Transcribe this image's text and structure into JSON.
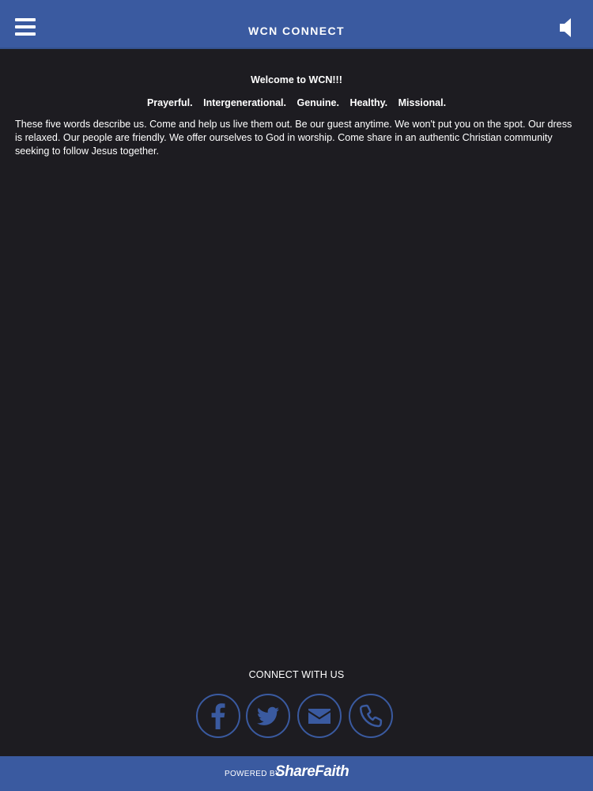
{
  "header": {
    "title": "WCN CONNECT",
    "menu_icon": "hamburger-menu-icon",
    "speaker_icon": "speaker-icon"
  },
  "content": {
    "welcome": "Welcome to WCN!!!",
    "values": [
      "Prayerful.",
      "Intergenerational.",
      "Genuine.",
      "Healthy.",
      "Missional."
    ],
    "description": "These five words describe us. Come and help us live them out.  Be our guest anytime. We won't put you on the spot. Our dress is relaxed. Our people are friendly. We offer ourselves to God in worship. Come share in an authentic Christian community seeking to follow Jesus together."
  },
  "connect": {
    "label": "CONNECT WITH US",
    "icons": [
      "facebook-icon",
      "twitter-icon",
      "email-icon",
      "phone-icon"
    ]
  },
  "footer": {
    "powered_by": "POWERED BY",
    "brand": "ShareFaith"
  },
  "colors": {
    "background": "#1d1c21",
    "accent": "#3a5aa0",
    "text": "#ffffff"
  }
}
